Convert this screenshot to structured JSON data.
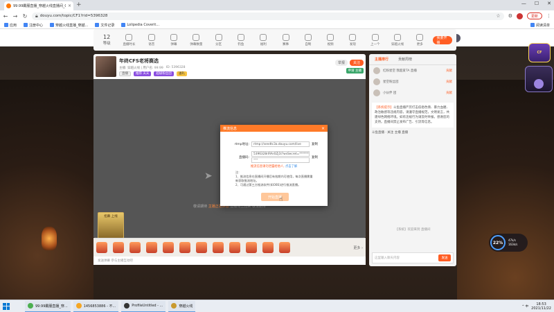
{
  "browser": {
    "tab_title": "99:99霸服直播_穿越火线直播间_C",
    "tab_close": "×",
    "newtab": "+",
    "url": "douyu.com/topic/CF1?rid=5396328",
    "window_controls": [
      "—",
      "☐",
      "✕"
    ],
    "update_label": "更新",
    "bookmarks": [
      "应用",
      "注册中心",
      "穿越火线直播_穿越...",
      "文件记录",
      "Lolipedia Coverit..."
    ],
    "reading_list": "阅读清单"
  },
  "site": {
    "logo": "斗鱼",
    "nav": [
      "首页",
      "直播",
      "分类",
      "视频",
      "游戏",
      "赛事"
    ]
  },
  "category_strip": {
    "level_num": "12",
    "level_label": "等级",
    "items": [
      "直播时长",
      "语音",
      "弹幕",
      "弹幕数量",
      "分区",
      "钓鱼",
      "福利",
      "赛事",
      "自制",
      "视频",
      "发现",
      "上一个",
      "穿越火线",
      "视频",
      "商店",
      "福利",
      "更多"
    ],
    "start_stream": "我要开播"
  },
  "stream": {
    "title": "年终CFS老将赛选",
    "line1": "主播: 穿越火线 | 用户名: 99:99",
    "line2": "ID: 5396328",
    "pills": [
      "直播",
      "推荐 天天",
      "超级粉丝团",
      "送礼"
    ],
    "follow": "关注",
    "report": "举报",
    "green": "申请 主播",
    "video_msg_prefix": "敬请期待 ",
    "video_msg_highlight": "主播正在休息",
    "video_msg_suffix": " 直播马上回来 敬请期待",
    "promo": "招募 上线"
  },
  "gift_bar": {
    "more": "更多 ›",
    "input": "发送弹幕 参与主播互动吧"
  },
  "right_panel": {
    "tabs": [
      "主播排行",
      "贡献周榜"
    ],
    "ranks": [
      {
        "name": "红粉星空 我超爱TA 直播",
        "tag": "贡献"
      },
      {
        "name": "星空粉丝团",
        "tag": "贡献"
      },
      {
        "name": "小伙伴 团",
        "tag": "贡献"
      }
    ],
    "notice_label": "【系统提示】",
    "notice": "斗鱼直播严厉打击低俗色情、暴力血腥、政治敏感等违规内容，请遵守直播规范，文明发言，共建绿色网络环境。如有违规行为请及时举报，感谢您的支持。直播间禁止发布广告、引流等信息。",
    "gift_row": "斗鱼直播 · 关注 主播 直播",
    "chat_tip": "【系统】欢迎来到 直播间",
    "input_placeholder": "这里输入聊天内容",
    "send": "发送"
  },
  "netstat": {
    "pct": "22%",
    "up": "47k/s",
    "down": "163k/s"
  },
  "dialog": {
    "title": "推流信息",
    "close": "×",
    "rtmp_label": "rtmp地址:",
    "rtmp_value": "rtmp://sendtc3a.douyu.com/live",
    "key_label": "直播码:",
    "key_value": "5396328rlRAr0Zj1t?wsSecret=**********",
    "key_value2": "***",
    "copy": "复制",
    "warn_prefix": "推流信息请勿泄露给他人, ",
    "warn_link": "点击了解",
    "notes": "注:\n1、推流信息在直播间开播后有效期内可使用，每次直播需重新获取推流地址。\n2、可通过第三方推流软件(如OBS)进行推流直播。",
    "button": "开始直播"
  },
  "taskbar": {
    "items": [
      "99:99霸服直播_穿...",
      "1456853886 - 不...",
      "ProfileUntitled - ...",
      "穿越火线"
    ],
    "tray": "^ 中",
    "time": "18:53",
    "date": "2021/11/22"
  }
}
